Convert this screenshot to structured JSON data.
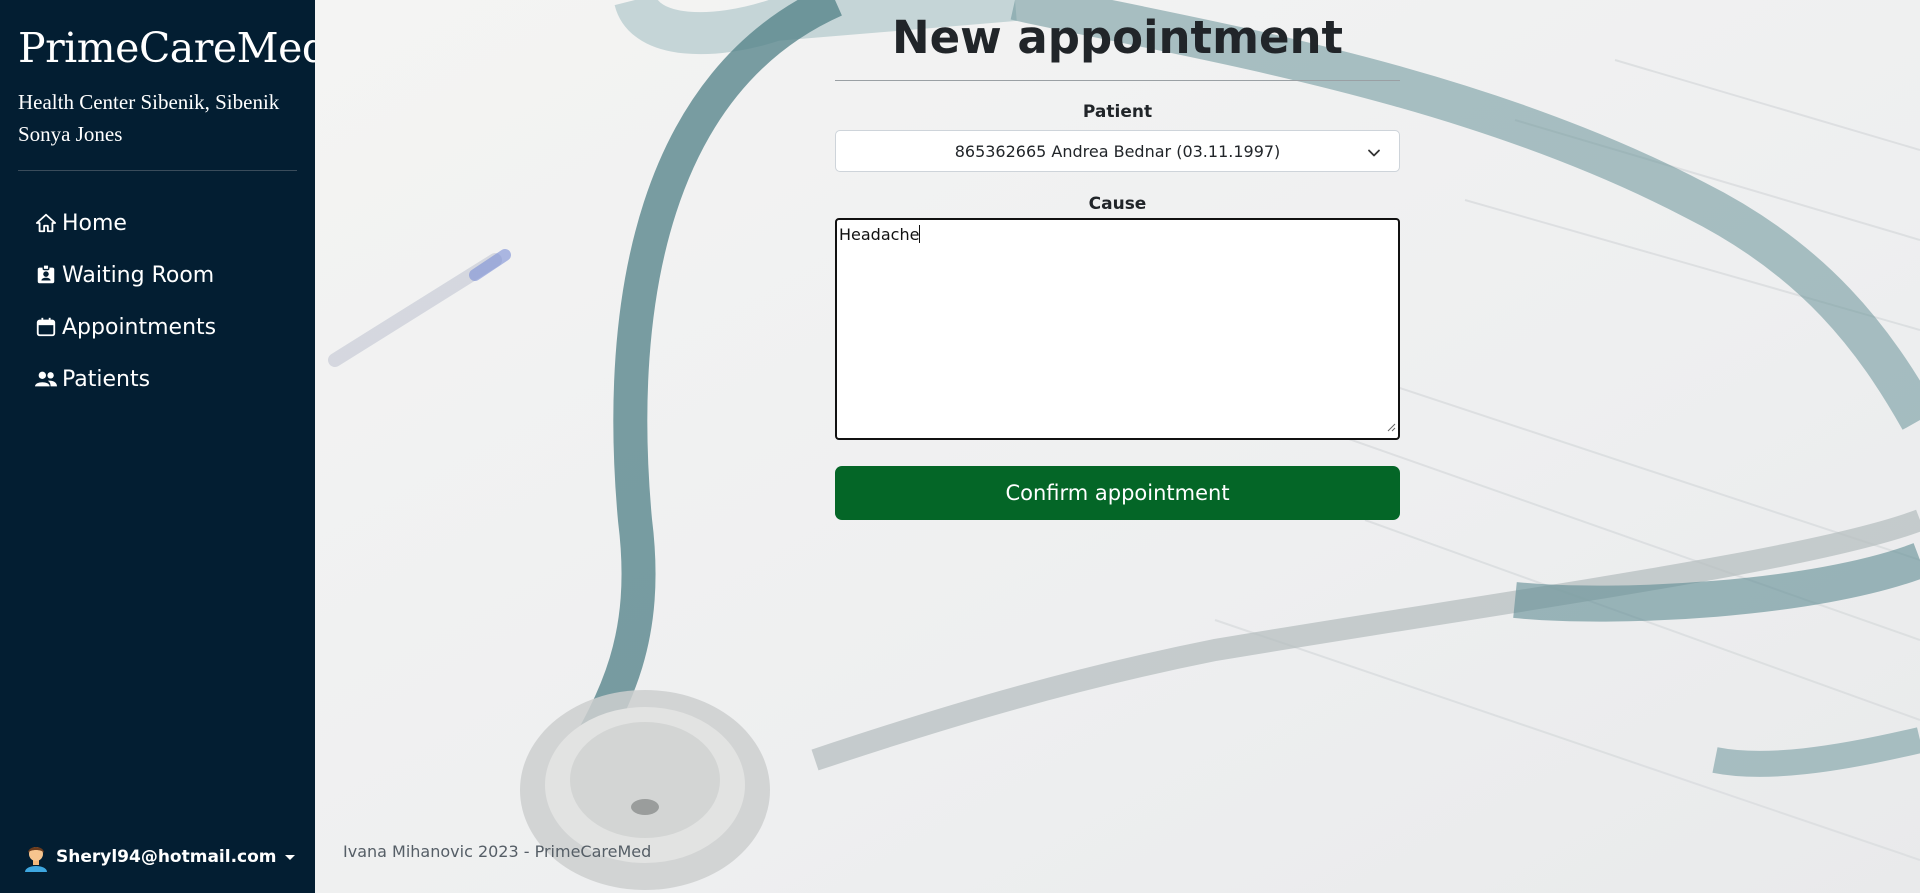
{
  "sidebar": {
    "brand": "PrimeCareMed",
    "health_center": "Health Center Sibenik, Sibenik",
    "doctor": "Sonya Jones",
    "nav": [
      {
        "label": "Home",
        "icon": "home-icon"
      },
      {
        "label": "Waiting Room",
        "icon": "id-badge-icon"
      },
      {
        "label": "Appointments",
        "icon": "calendar-icon"
      },
      {
        "label": "Patients",
        "icon": "users-icon"
      }
    ],
    "user": {
      "email": "Sheryl94@hotmail.com",
      "icon": "user-avatar-icon"
    }
  },
  "form": {
    "title": "New appointment",
    "patient_label": "Patient",
    "patient_selected": "865362665 Andrea Bednar (03.11.1997)",
    "cause_label": "Cause",
    "cause_value": "Headache",
    "confirm_label": "Confirm appointment"
  },
  "footer": {
    "text": "Ivana Mihanovic 2023 - PrimeCareMed"
  },
  "colors": {
    "sidebar_bg": "#031e32",
    "confirm_bg": "#046627"
  }
}
